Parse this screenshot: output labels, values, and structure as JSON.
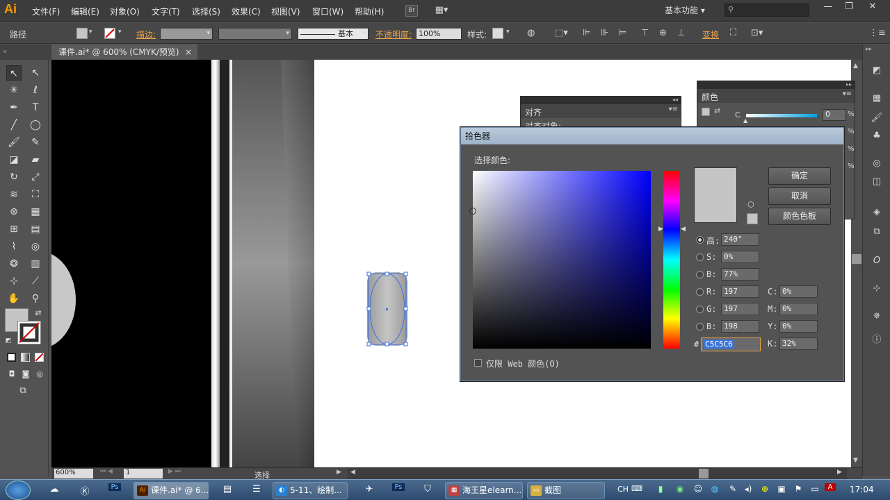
{
  "app": {
    "logo": "Ai"
  },
  "menu": [
    "文件(F)",
    "编辑(E)",
    "对象(O)",
    "文字(T)",
    "选择(S)",
    "效果(C)",
    "视图(V)",
    "窗口(W)",
    "帮助(H)"
  ],
  "bridge_chip": "Br",
  "workspace": "基本功能",
  "control": {
    "object_label": "路径",
    "stroke_label": "描边:",
    "stroke_style": "基本",
    "opacity_label": "不透明度:",
    "opacity_value": "100%",
    "style_label": "样式:",
    "transform_label": "变换"
  },
  "document_tab": {
    "title": "课件.ai* @ 600% (CMYK/预览)",
    "close": "×"
  },
  "panels": {
    "align_title": "对齐",
    "align_sub": "对齐对象:",
    "color_title": "颜色",
    "color_c_label": "C",
    "color_c_value": "0",
    "percent": "%"
  },
  "picker": {
    "title": "拾色器",
    "select_label": "选择颜色:",
    "ok": "确定",
    "cancel": "取消",
    "swatches": "颜色色板",
    "labels": {
      "h": "高:",
      "s": "S:",
      "b": "B:",
      "r": "R:",
      "g": "G:",
      "b2": "B:",
      "hash": "#",
      "c": "C:",
      "m": "M:",
      "y": "Y:",
      "k": "K:"
    },
    "values": {
      "h": "240°",
      "s": "0%",
      "b": "77%",
      "r": "197",
      "g": "197",
      "b2": "198",
      "hex": "C5C5C6",
      "c": "0%",
      "m": "0%",
      "y": "0%",
      "k": "32%"
    },
    "web_only": "仅限 Web 颜色(O)",
    "current_color": "#c5c5c6",
    "hue_color": "#0000ff"
  },
  "status": {
    "zoom": "600%",
    "artboard": "1",
    "mode": "选择"
  },
  "taskbar": {
    "tasks": [
      "课件.ai* @ 6...",
      "5-11、绘制...",
      "海王星elearn...",
      "截图"
    ],
    "ime": "CH",
    "clock": "17:04"
  }
}
